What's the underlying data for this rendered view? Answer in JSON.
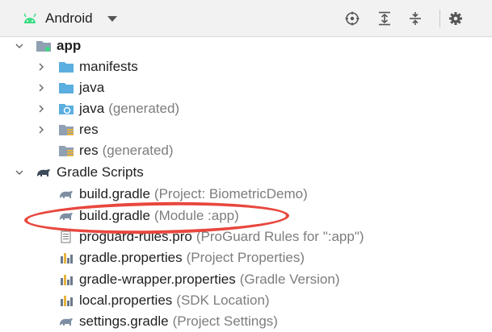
{
  "toolbar": {
    "view_label": "Android",
    "icons": [
      "locate-icon",
      "expand-all-icon",
      "collapse-all-icon",
      "settings-icon"
    ]
  },
  "tree": {
    "app": {
      "label": "app"
    },
    "manifests": {
      "label": "manifests"
    },
    "java": {
      "label": "java"
    },
    "java_generated": {
      "label": "java",
      "hint": "(generated)"
    },
    "res": {
      "label": "res"
    },
    "res_generated": {
      "label": "res",
      "hint": "(generated)"
    },
    "gradle_scripts": {
      "label": "Gradle Scripts"
    },
    "build_gradle_project": {
      "label": "build.gradle",
      "hint": "(Project: BiometricDemo)"
    },
    "build_gradle_module": {
      "label": "build.gradle",
      "hint": "(Module :app)"
    },
    "proguard": {
      "label": "proguard-rules.pro",
      "hint": "(ProGuard Rules for \":app\")"
    },
    "gradle_properties": {
      "label": "gradle.properties",
      "hint": "(Project Properties)"
    },
    "gradle_wrapper": {
      "label": "gradle-wrapper.properties",
      "hint": "(Gradle Version)"
    },
    "local_properties": {
      "label": "local.properties",
      "hint": "(SDK Location)"
    },
    "settings_gradle": {
      "label": "settings.gradle",
      "hint": "(Project Settings)"
    }
  },
  "colors": {
    "folder_blue": "#5aaee0",
    "android_green": "#3ddc84",
    "highlight_red": "#e8473e"
  }
}
